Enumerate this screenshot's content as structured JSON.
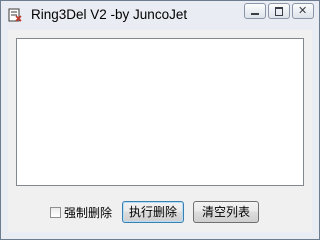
{
  "window": {
    "title": "Ring3Del V2 -by JuncoJet",
    "icon": "app-icon",
    "controls": {
      "minimize": "minimize-icon",
      "maximize": "maximize-icon",
      "close": "close-icon"
    },
    "close_glyph": "✕"
  },
  "list": {
    "items": []
  },
  "options": {
    "force_delete_label": "强制删除",
    "force_delete_checked": false
  },
  "buttons": {
    "execute_label": "执行删除",
    "clear_label": "清空列表"
  },
  "colors": {
    "frame": "#e9ecf2",
    "client": "#f0f0f0",
    "default_button_border": "#3c7fb1"
  }
}
